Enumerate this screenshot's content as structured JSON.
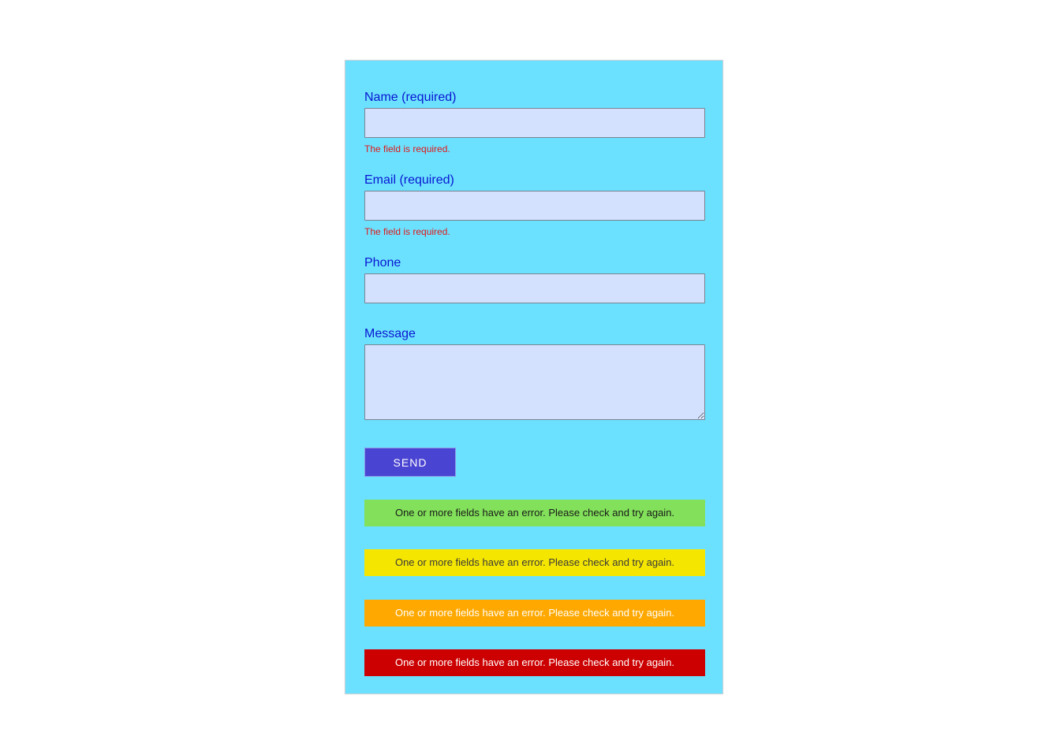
{
  "form": {
    "name_label": "Name (required)",
    "name_error": "The field is required.",
    "email_label": "Email (required)",
    "email_error": "The field is required.",
    "phone_label": "Phone",
    "message_label": "Message",
    "send_label": "SEND"
  },
  "messages": [
    {
      "text": "One or more fields have an error. Please check and try again.",
      "bg": "#82e05a",
      "fg": "#1a1a1a"
    },
    {
      "text": "One or more fields have an error. Please check and try again.",
      "bg": "#f5e600",
      "fg": "#3a3a3a"
    },
    {
      "text": "One or more fields have an error. Please check and try again.",
      "bg": "#ffa800",
      "fg": "#ffffff"
    },
    {
      "text": "One or more fields have an error. Please check and try again.",
      "bg": "#cc0000",
      "fg": "#ffffff"
    }
  ],
  "colors": {
    "card_bg": "#6be1ff",
    "label": "#0a16d1",
    "field_bg": "#d3e1fe",
    "error_text": "#e01818",
    "button_bg": "#4a44d2"
  }
}
